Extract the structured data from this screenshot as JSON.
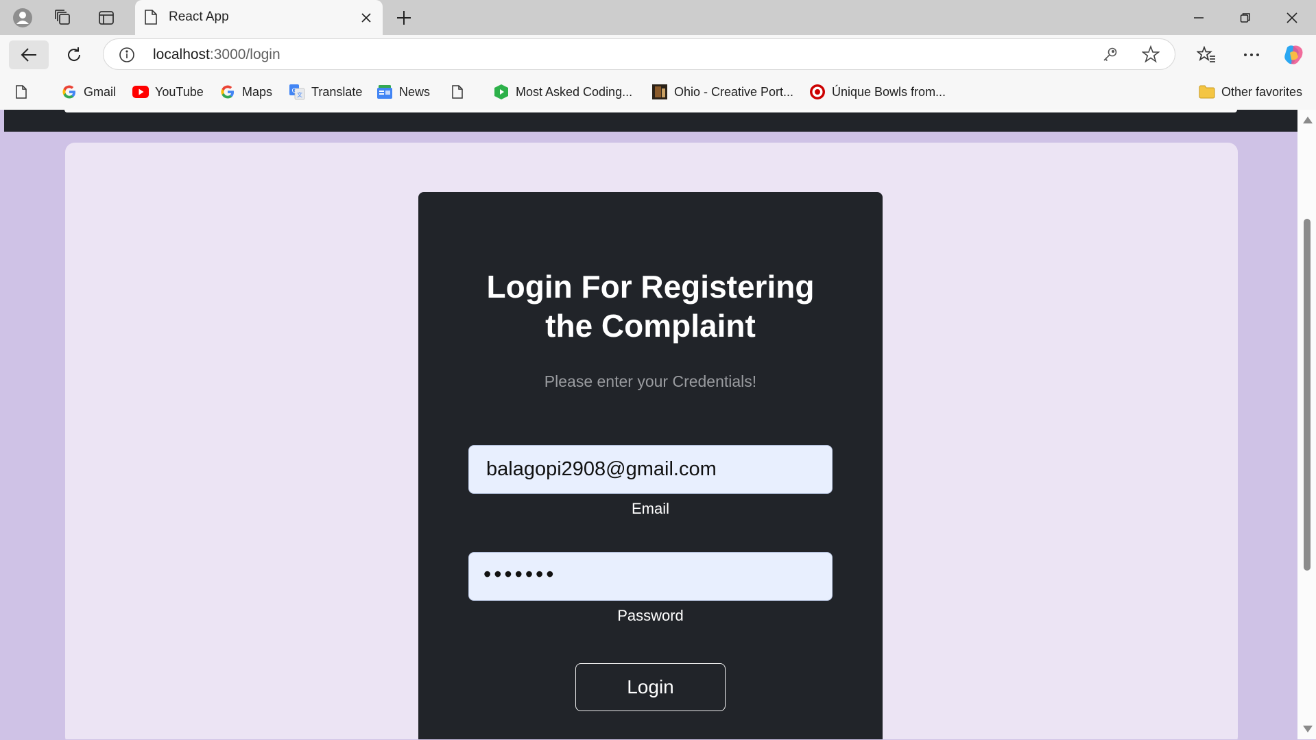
{
  "browser": {
    "tab_title": "React App",
    "address_host": "localhost",
    "address_path": ":3000/login"
  },
  "bookmarks": {
    "items": [
      {
        "label": "Gmail",
        "icon": "google-icon"
      },
      {
        "label": "YouTube",
        "icon": "youtube-icon"
      },
      {
        "label": "Maps",
        "icon": "google-icon"
      },
      {
        "label": "Translate",
        "icon": "translate-icon"
      },
      {
        "label": "News",
        "icon": "news-icon"
      },
      {
        "label": "Most Asked Coding...",
        "icon": "green-shield-icon"
      },
      {
        "label": "Ohio - Creative Port...",
        "icon": "portfolio-thumb-icon"
      },
      {
        "label": "Únique Bowls from...",
        "icon": "target-icon"
      }
    ],
    "other_favorites": "Other favorites"
  },
  "login": {
    "title_line1": "Login For Registering",
    "title_line2": "the Complaint",
    "subtitle": "Please enter your Credentials!",
    "email_value": "balagopi2908@gmail.com",
    "email_label": "Email",
    "password_mask": "•••••••",
    "password_label": "Password",
    "button_label": "Login"
  },
  "colors": {
    "page_bg": "#cfc2e6",
    "panel_bg": "#ece4f4",
    "card_bg": "#212429",
    "input_bg": "#e8effe"
  }
}
